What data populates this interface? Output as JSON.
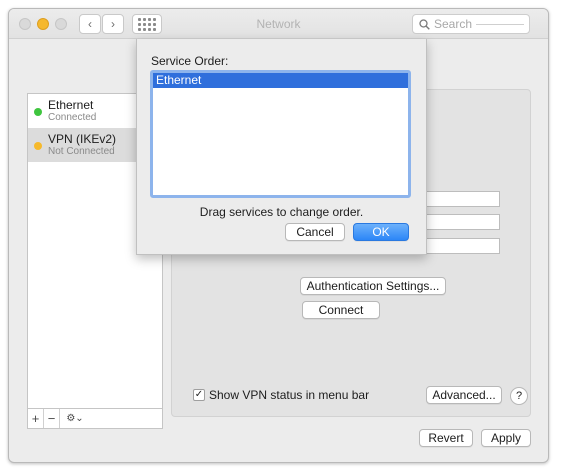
{
  "window": {
    "title": "Network",
    "search": {
      "placeholder": "Search"
    }
  },
  "sidebar": {
    "items": [
      {
        "name": "Ethernet",
        "status": "Connected",
        "status_color": "#3fc53f"
      },
      {
        "name": "VPN (IKEv2)",
        "status": "Not Connected",
        "status_color": "#f6b92b"
      }
    ],
    "toolbar": {
      "add": "+",
      "remove": "−",
      "action": "⚙⌄"
    }
  },
  "panel": {
    "auth_button": "Authentication Settings...",
    "connect_button": "Connect",
    "show_vpn_label": "Show VPN status in menu bar",
    "show_vpn_checked": true,
    "advanced_button": "Advanced...",
    "help": "?"
  },
  "footer": {
    "revert": "Revert",
    "apply": "Apply"
  },
  "sheet": {
    "title": "Service Order:",
    "items": [
      "Ethernet"
    ],
    "hint": "Drag services to change order.",
    "cancel": "Cancel",
    "ok": "OK"
  },
  "colors": {
    "accent": "#2f6fdc",
    "focus_ring": "#8db4ec"
  }
}
